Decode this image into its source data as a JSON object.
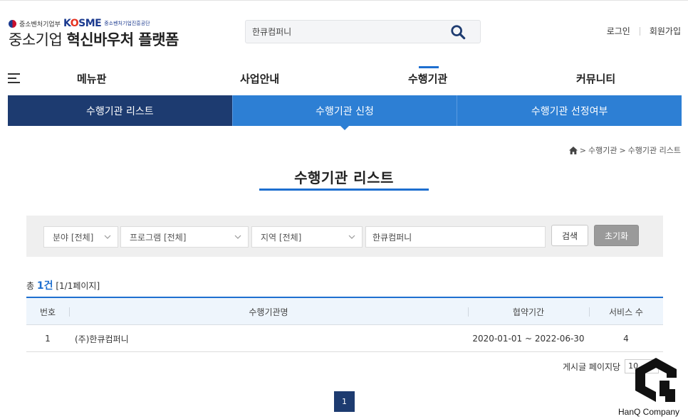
{
  "header": {
    "gov_name": "중소벤처기업부",
    "kosme_logo": "KOSME",
    "kosme_sub": "중소벤처기업진흥공단",
    "site_title_plain": "중소기업",
    "site_title_bold": "혁신바우처 플랫폼",
    "search_value": "한큐컴퍼니",
    "login": "로그인",
    "signup": "회원가입"
  },
  "gnb": {
    "items": [
      "메뉴판",
      "사업안내",
      "수행기관",
      "커뮤니티"
    ],
    "active": "수행기관"
  },
  "subtabs": [
    "수행기관 리스트",
    "수행기관 신청",
    "수행기관 선정여부"
  ],
  "breadcrumb": [
    "수행기관",
    "수행기관 리스트"
  ],
  "page_title": "수행기관 리스트",
  "filter": {
    "field": "분야 [전체]",
    "program": "프로그램 [전체]",
    "region": "지역 [전체]",
    "keyword": "한큐컴퍼니",
    "search_label": "검색",
    "reset_label": "초기화"
  },
  "count": {
    "prefix": "총",
    "total": "1건",
    "pages": "[1/1페이지]"
  },
  "table": {
    "headers": [
      "번호",
      "수행기관명",
      "협약기간",
      "서비스 수"
    ],
    "rows": [
      {
        "no": "1",
        "name": "(주)한큐컴퍼니",
        "period": "2020-01-01 ~ 2022-06-30",
        "services": "4"
      }
    ]
  },
  "per_page_label": "게시글 페이지당",
  "per_page_value": "10",
  "pagination": {
    "current": "1"
  },
  "watermark": {
    "text": "HanQ Company"
  },
  "colors": {
    "navy": "#1d3b70",
    "blue": "#2d7fd4",
    "accent": "#1e6fd0"
  },
  "icons": {
    "search": "search-icon",
    "home": "home-icon",
    "menu": "hamburger-icon",
    "dropdown": "chevron-down-icon"
  }
}
